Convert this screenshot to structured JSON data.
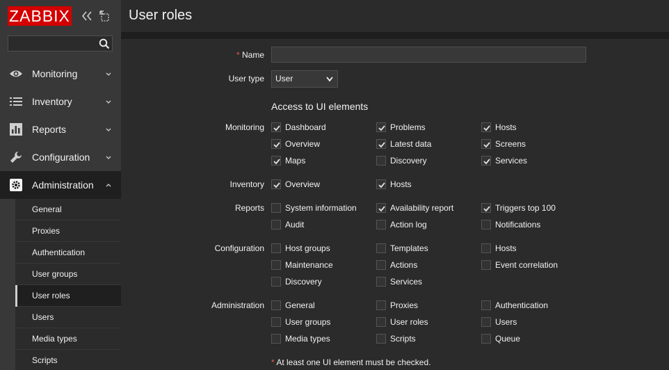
{
  "app": {
    "logo": "ZABBIX"
  },
  "search": {
    "value": "",
    "placeholder": ""
  },
  "nav": {
    "items": [
      {
        "label": "Monitoring",
        "icon": "eye-icon"
      },
      {
        "label": "Inventory",
        "icon": "list-icon"
      },
      {
        "label": "Reports",
        "icon": "bar-chart-icon"
      },
      {
        "label": "Configuration",
        "icon": "wrench-icon"
      },
      {
        "label": "Administration",
        "icon": "gear-icon"
      }
    ],
    "submenu": [
      "General",
      "Proxies",
      "Authentication",
      "User groups",
      "User roles",
      "Users",
      "Media types",
      "Scripts"
    ],
    "selected_sub": "User roles"
  },
  "header": {
    "title": "User roles"
  },
  "form": {
    "name_label": "Name",
    "required_mark": "*",
    "name_value": "",
    "user_type_label": "User type",
    "user_type_value": "User",
    "access_title": "Access to UI elements",
    "groups": {
      "monitoring": {
        "label": "Monitoring",
        "items": [
          {
            "label": "Dashboard",
            "checked": true
          },
          {
            "label": "Problems",
            "checked": true
          },
          {
            "label": "Hosts",
            "checked": true
          },
          {
            "label": "Overview",
            "checked": true
          },
          {
            "label": "Latest data",
            "checked": true
          },
          {
            "label": "Screens",
            "checked": true
          },
          {
            "label": "Maps",
            "checked": true
          },
          {
            "label": "Discovery",
            "checked": false
          },
          {
            "label": "Services",
            "checked": true
          }
        ]
      },
      "inventory": {
        "label": "Inventory",
        "items": [
          {
            "label": "Overview",
            "checked": true
          },
          {
            "label": "Hosts",
            "checked": true
          }
        ]
      },
      "reports": {
        "label": "Reports",
        "items": [
          {
            "label": "System information",
            "checked": false
          },
          {
            "label": "Availability report",
            "checked": true
          },
          {
            "label": "Triggers top 100",
            "checked": true
          },
          {
            "label": "Audit",
            "checked": false
          },
          {
            "label": "Action log",
            "checked": false
          },
          {
            "label": "Notifications",
            "checked": false
          }
        ]
      },
      "configuration": {
        "label": "Configuration",
        "items": [
          {
            "label": "Host groups",
            "checked": false
          },
          {
            "label": "Templates",
            "checked": false
          },
          {
            "label": "Hosts",
            "checked": false
          },
          {
            "label": "Maintenance",
            "checked": false
          },
          {
            "label": "Actions",
            "checked": false
          },
          {
            "label": "Event correlation",
            "checked": false
          },
          {
            "label": "Discovery",
            "checked": false
          },
          {
            "label": "Services",
            "checked": false
          }
        ]
      },
      "administration": {
        "label": "Administration",
        "items": [
          {
            "label": "General",
            "checked": false
          },
          {
            "label": "Proxies",
            "checked": false
          },
          {
            "label": "Authentication",
            "checked": false
          },
          {
            "label": "User groups",
            "checked": false
          },
          {
            "label": "User roles",
            "checked": false
          },
          {
            "label": "Users",
            "checked": false
          },
          {
            "label": "Media types",
            "checked": false
          },
          {
            "label": "Scripts",
            "checked": false
          },
          {
            "label": "Queue",
            "checked": false
          }
        ]
      }
    },
    "footnote": "At least one UI element must be checked."
  },
  "colors": {
    "logo_bg": "#d40000",
    "required": "#e45959",
    "sidebar_bg": "#383838",
    "main_bg": "#2b2b2b"
  }
}
